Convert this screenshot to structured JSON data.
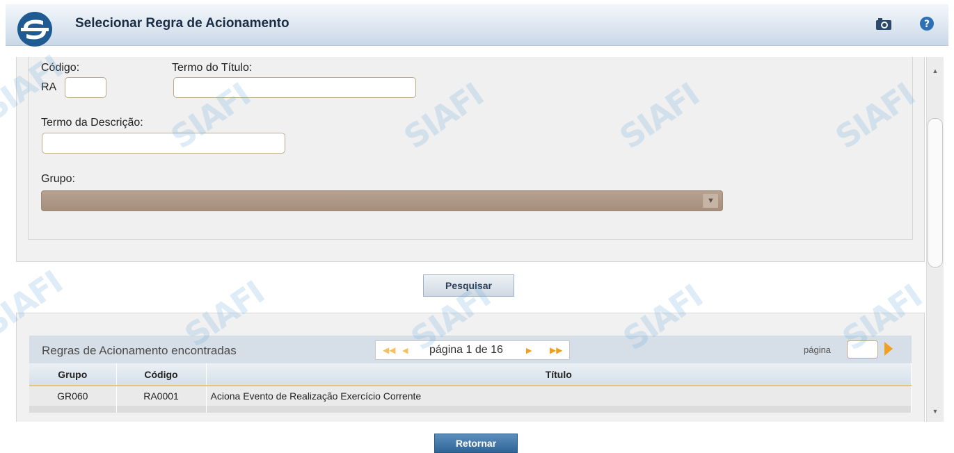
{
  "header": {
    "title": "Selecionar Regra de Acionamento",
    "camera_icon": "camera-icon",
    "help_icon": "help-icon"
  },
  "filters": {
    "codigo_label": "Código:",
    "codigo_prefix": "RA",
    "codigo_value": "",
    "termo_titulo_label": "Termo do Título:",
    "termo_titulo_value": "",
    "termo_descricao_label": "Termo da Descrição:",
    "termo_descricao_value": "",
    "grupo_label": "Grupo:",
    "grupo_value": ""
  },
  "search_button": "Pesquisar",
  "results": {
    "title": "Regras de Acionamento encontradas",
    "pager_text": "página 1 de 16",
    "goto_label": "página",
    "goto_value": "",
    "columns": [
      "Grupo",
      "Código",
      "Título"
    ],
    "rows": [
      {
        "grupo": "GR060",
        "codigo": "RA0001",
        "titulo": "Aciona Evento de Realização Exercício Corrente"
      }
    ]
  },
  "return_button": "Retornar",
  "watermark_text": "SIAFI",
  "colors": {
    "header_bg": "#dde7f1",
    "select_bg": "#a58e7c",
    "pager_arrow": "#f0a020",
    "return_btn": "#2f6497"
  }
}
